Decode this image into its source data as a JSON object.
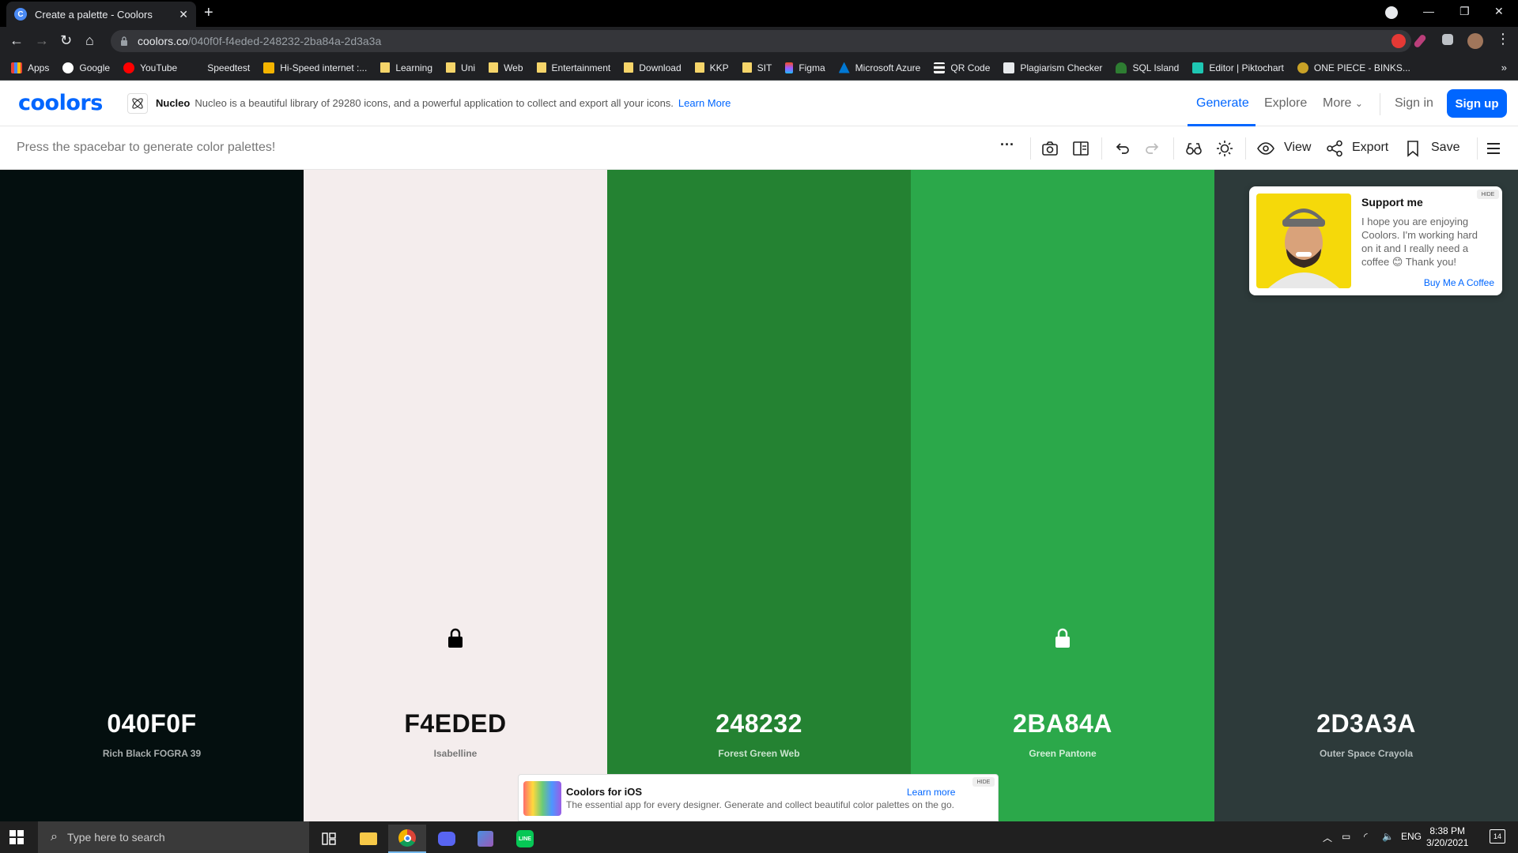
{
  "browser": {
    "tab_title": "Create a palette - Coolors",
    "url_host": "coolors.co",
    "url_path": "/040f0f-f4eded-248232-2ba84a-2d3a3a",
    "bookmarks": [
      "Apps",
      "Google",
      "YouTube",
      "Speedtest",
      "Hi-Speed internet :...",
      "Learning",
      "Uni",
      "Web",
      "Entertainment",
      "Download",
      "KKP",
      "SIT",
      "Figma",
      "Microsoft Azure",
      "QR Code",
      "Plagiarism Checker",
      "SQL Island",
      "Editor | Piktochart",
      "ONE PIECE - BINKS..."
    ],
    "bookmark_more": "»"
  },
  "header": {
    "logo": "coolors",
    "ad_brand": "Nucleo",
    "ad_text": "Nucleo is a beautiful library of 29280 icons, and a powerful application to collect and export all your icons.",
    "ad_link": "Learn More",
    "nav": {
      "generate": "Generate",
      "explore": "Explore",
      "more": "More",
      "signin": "Sign in",
      "signup": "Sign up"
    }
  },
  "toolbar": {
    "hint": "Press the spacebar to generate color palettes!",
    "more": "···",
    "view": "View",
    "export": "Export",
    "save": "Save"
  },
  "palette": [
    {
      "hex": "040F0F",
      "name": "Rich Black FOGRA 39",
      "bg": "#040f0f",
      "fg": "#ffffff",
      "sub": "#a8adad",
      "locked": false
    },
    {
      "hex": "F4EDED",
      "name": "Isabelline",
      "bg": "#f4eded",
      "fg": "#111111",
      "sub": "#777777",
      "locked": true,
      "lock_color": "#000000"
    },
    {
      "hex": "248232",
      "name": "Forest Green Web",
      "bg": "#248232",
      "fg": "#ffffff",
      "sub": "#c9e3cd",
      "locked": false
    },
    {
      "hex": "2BA84A",
      "name": "Green Pantone",
      "bg": "#2ba84a",
      "fg": "#ffffff",
      "sub": "#d2eed8",
      "locked": true,
      "lock_color": "#ffffff"
    },
    {
      "hex": "2D3A3A",
      "name": "Outer Space Crayola",
      "bg": "#2d3a3a",
      "fg": "#ffffff",
      "sub": "#b8c0c0",
      "locked": false
    }
  ],
  "support": {
    "hide": "HIDE",
    "title": "Support me",
    "body": "I hope you are enjoying Coolors. I'm working hard on it and I really need a coffee 😊 Thank you!",
    "link": "Buy Me A Coffee"
  },
  "ios_banner": {
    "hide": "HIDE",
    "title": "Coolors for iOS",
    "body": "The essential app for every designer. Generate and collect beautiful color palettes on the go.",
    "link": "Learn more"
  },
  "taskbar": {
    "search_placeholder": "Type here to search",
    "lang": "ENG",
    "time": "8:38 PM",
    "date": "3/20/2021",
    "notifications": "14"
  },
  "colors": {
    "accent": "#0066ff"
  }
}
